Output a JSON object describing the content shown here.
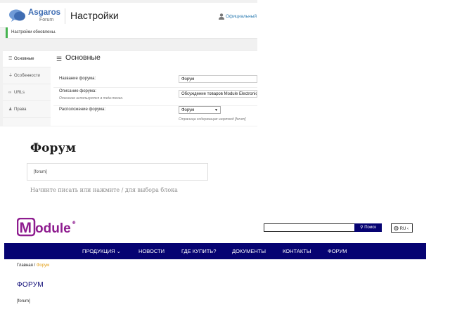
{
  "admin": {
    "logo": {
      "name": "Asgaros",
      "sub": "Forum"
    },
    "title": "Настройки",
    "user_link": "Официальный",
    "notice": "Настройки обновлены.",
    "tabs": [
      {
        "label": "Основные",
        "icon": "sliders-icon",
        "active": true
      },
      {
        "label": "Особенности",
        "icon": "plug-icon",
        "active": false
      },
      {
        "label": "URLs",
        "icon": "link-icon",
        "active": false
      },
      {
        "label": "Права",
        "icon": "users-icon",
        "active": false
      }
    ],
    "section_title": "Основные",
    "fields": {
      "forum_name": {
        "label": "Название форума:",
        "value": "Форум"
      },
      "forum_description": {
        "label": "Описание форума:",
        "description": "Описание используется в meta-тегах.",
        "value": "Обсуждение товаров Module Electronic"
      },
      "forum_location": {
        "label": "Расположение форума:",
        "value": "Форум",
        "hint": "Страница содержащая шорткод [forum]"
      }
    }
  },
  "editor": {
    "title": "Форум",
    "shortcode": "[forum]",
    "placeholder": "Начните писать или нажмите / для выбора блока"
  },
  "site": {
    "logo_text": "Module",
    "logo_sup": "e",
    "search_button": "Поиск",
    "lang": "RU",
    "colors": {
      "brand": "#060372",
      "logo": "#8e1c8f",
      "breadcrumb_current": "#e3a11a"
    },
    "nav": [
      "ПРОДУКЦИЯ",
      "НОВОСТИ",
      "ГДЕ КУПИТЬ?",
      "ДОКУМЕНТЫ",
      "КОНТАКТЫ",
      "ФОРУМ"
    ],
    "breadcrumb": {
      "home": "Главная",
      "sep": "/",
      "current": "Форум"
    },
    "heading": "ФОРУМ",
    "content": "[forum]"
  }
}
